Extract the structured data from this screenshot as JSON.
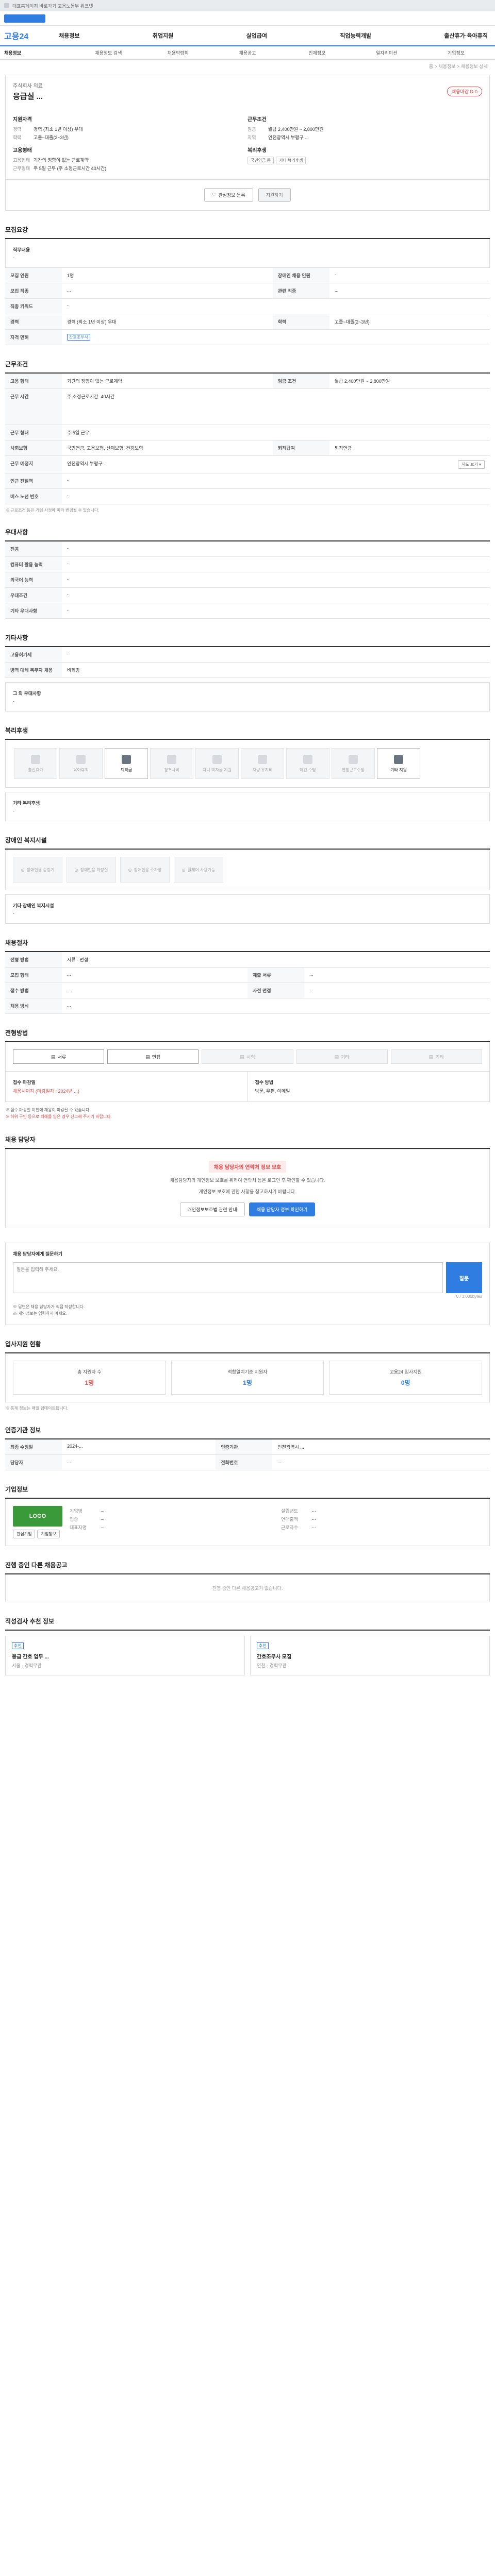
{
  "top": {
    "notice": "대표홈페이지 바로가기 고용노동부 워크넷"
  },
  "header": {
    "logo": "고용24",
    "menu": [
      "채용정보",
      "취업지원",
      "실업급여",
      "직업능력개발",
      "출산휴가·육아휴직"
    ],
    "subnav": [
      "채용정보",
      "채용정보 검색",
      "채용박람회",
      "채용공고",
      "인재정보",
      "일자리미션",
      "기업정보"
    ],
    "breadcrumb": "홈 > 채용정보 > 채용정보 상세"
  },
  "title": {
    "corp": "주식회사 의료",
    "heading": "응급실 ...",
    "badge": "채용마감 D-0"
  },
  "summary": {
    "career_h": "지원자격",
    "career": [
      {
        "k": "경력",
        "v": "경력 (최소 1년 이상) 우대"
      },
      {
        "k": "학력",
        "v": "고졸~대졸(2~3년)"
      }
    ],
    "cond_h": "근무조건",
    "cond": [
      {
        "k": "임금",
        "v": "월급 2,400만원 ~ 2,800만원"
      },
      {
        "k": "지역",
        "v": "인천광역시 부평구 ..."
      }
    ],
    "emp_h": "고용형태",
    "emp": [
      {
        "k": "고용형태",
        "v": "기간의 정함이 없는 근로계약"
      },
      {
        "k": "근무형태",
        "v": "주 5일 근무 (주 소정근로시간 40시간)"
      }
    ],
    "welfare_h": "복리후생",
    "welfare_pills": [
      "국민연금 등",
      "기타 복리후생"
    ]
  },
  "actions": {
    "fav": "관심정보 등록",
    "apply": "지원하기"
  },
  "sections": {
    "recruit": {
      "title": "모집요강",
      "label": "직무내용",
      "val": "-"
    },
    "recruit_tbl": [
      {
        "k": "모집 인원",
        "v": "1명",
        "k2": "장애인 채용 인원",
        "v2": "-"
      },
      {
        "k": "모집 직종",
        "v": "...",
        "k2": "관련 직종",
        "v2": "..."
      },
      {
        "k": "직종 키워드",
        "v": "-",
        "k2": "",
        "v2": ""
      },
      {
        "k": "경력",
        "v": "경력 (최소 1년 이상) 우대",
        "k2": "학력",
        "v2": "고졸~대졸(2~3년)"
      },
      {
        "k": "자격 면허",
        "v": "간호조무사",
        "k2": "",
        "v2": ""
      }
    ],
    "work": {
      "title": "근무조건"
    },
    "work_tbl": [
      {
        "k": "고용 형태",
        "v": "기간의 정함이 없는 근로계약",
        "k2": "임금 조건",
        "v2": "월급 2,400만원 ~ 2,800만원"
      },
      {
        "k": "근무 시간",
        "v": "주 소정근로시간: 40시간",
        "k2": "",
        "v2": ""
      },
      {
        "k": "근무 형태",
        "v": "주 5일 근무",
        "k2": "",
        "v2": ""
      },
      {
        "k": "사회보험",
        "v": "국민연금, 고용보험, 산재보험, 건강보험",
        "k2": "퇴직급여",
        "v2": "퇴직연금"
      },
      {
        "k": "근무 예정지",
        "v": "인천광역시 부평구 ...",
        "k2": "",
        "v2": ""
      },
      {
        "k": "인근 전철역",
        "v": "-",
        "k2": "",
        "v2": ""
      },
      {
        "k": "버스 노선 번호",
        "v": "-",
        "k2": "",
        "v2": ""
      }
    ],
    "work_note": "※ 근로조건 등은 기업 사정에 따라 변경될 수 있습니다.",
    "pref": {
      "title": "우대사항"
    },
    "pref_tbl": [
      {
        "k": "전공",
        "v": "-"
      },
      {
        "k": "컴퓨터 활용 능력",
        "v": "-"
      },
      {
        "k": "외국어 능력",
        "v": "-"
      },
      {
        "k": "우대조건",
        "v": "-"
      },
      {
        "k": "기타 우대사항",
        "v": "-"
      }
    ],
    "etc": {
      "title": "기타사항"
    },
    "etc_tbl": [
      {
        "k": "고용허가제",
        "v": "-"
      },
      {
        "k": "병역 대체 복무자 채용",
        "v": "비희망"
      }
    ],
    "etc_box": {
      "label": "그 외 우대사항",
      "val": "-"
    },
    "welfare": {
      "title": "복리후생"
    },
    "welfare_items": [
      {
        "n": "출산휴가",
        "on": false
      },
      {
        "n": "육아휴직",
        "on": false
      },
      {
        "n": "퇴직금",
        "on": true
      },
      {
        "n": "경조사비",
        "on": false
      },
      {
        "n": "자녀 학자금 지원",
        "on": false
      },
      {
        "n": "차량 유지비",
        "on": false
      },
      {
        "n": "야간 수당",
        "on": false
      },
      {
        "n": "연장근로수당",
        "on": false
      },
      {
        "n": "기타 지원",
        "on": true
      }
    ],
    "welfare_box": {
      "label": "기타 복리후생",
      "val": "-"
    },
    "dis": {
      "title": "장애인 복지시설"
    },
    "dis_items": [
      "장애인용 승강기",
      "장애인용 화장실",
      "장애인용 주차장",
      "휠체어 사용가능"
    ],
    "dis_box": {
      "label": "기타 장애인 복지시설",
      "val": "-"
    },
    "proc": {
      "title": "채용절차"
    },
    "proc_tbl": [
      {
        "k": "전형 방법",
        "v": "서류 - 면접",
        "k2": "",
        "v2": ""
      },
      {
        "k": "모집 형태",
        "v": "...",
        "k2": "제출 서류",
        "v2": "..."
      },
      {
        "k": "접수 방법",
        "v": "...",
        "k2": "사전 면접",
        "v2": "..."
      },
      {
        "k": "채용 방식",
        "v": "...",
        "k2": "",
        "v2": ""
      }
    ],
    "apply": {
      "title": "전형방법"
    },
    "apply_tabs": [
      "서류",
      "면접",
      "시험",
      "기타",
      "기타"
    ],
    "apply_left": {
      "h": "접수 마감일",
      "v": "채용시까지 (마감일자 : 2024년 ...)"
    },
    "apply_right": {
      "h": "접수 방법",
      "v": "방문, 우편, 이메일"
    },
    "apply_bullets": [
      "※ 접수 마감일 이전에 채용이 마감될 수 있습니다.",
      "※ 허위 구인 등으로 피해를 입은 경우 신고해 주시기 바랍니다."
    ],
    "contact": {
      "title": "채용 담당자",
      "warn": "채용 담당자의 연락처 정보 보호",
      "p1": "채용담당자의 개인정보 보호를 위하여 연락처 등은 로그인 후 확인할 수 있습니다.",
      "p2": "개인정보 보호에 관한 사항을 참고하시기 바랍니다.",
      "btn1": "개인정보보호법 관련 안내",
      "btn2": "채용 담당자 정보 확인하기"
    },
    "qa": {
      "title": "채용 담당자에게 질문하기",
      "hint": "질문을 입력해 주세요.",
      "submit": "질문",
      "count": "0 / 1,000bytes",
      "bullets": [
        "※ 답변은 채용 담당자가 직접 작성합니다.",
        "※ 개인정보는 입력하지 마세요."
      ]
    },
    "stats": {
      "title": "입사지원 현황",
      "items": [
        {
          "l": "총 지원자 수",
          "n": "1명"
        },
        {
          "l": "적합일치기준 지원자",
          "n": "1명"
        },
        {
          "l": "고용24 입사지원",
          "n": "0명"
        }
      ],
      "note": "※ 통계 정보는 매일 업데이트됩니다."
    },
    "info": {
      "title": "인증기관 정보"
    },
    "info_tbl": [
      {
        "k": "최종 수정일",
        "v": "2024-...",
        "k2": "인증기관",
        "v2": "인천광역시 ..."
      },
      {
        "k": "담당자",
        "v": "...",
        "k2": "전화번호",
        "v2": "..."
      }
    ],
    "corp": {
      "title": "기업정보",
      "logo": "LOGO",
      "btns": [
        "관심기업",
        "기업정보"
      ],
      "rows1": [
        {
          "k": "기업명",
          "v": "..."
        },
        {
          "k": "업종",
          "v": "..."
        },
        {
          "k": "대표자명",
          "v": "..."
        }
      ],
      "rows2": [
        {
          "k": "설립년도",
          "v": "..."
        },
        {
          "k": "연매출액",
          "v": "..."
        },
        {
          "k": "근로자수",
          "v": "..."
        }
      ]
    },
    "ongoing": {
      "title": "진행 중인 다른 채용공고",
      "empty": "진행 중인 다른 채용공고가 없습니다."
    },
    "recs": {
      "title": "적성검사 추천 정보",
      "items": [
        {
          "chip": "추천",
          "t": "응급 간호 업무 ...",
          "m": "서울 · 경력무관"
        },
        {
          "chip": "추천",
          "t": "간호조무사 모집",
          "m": "인천 · 경력무관"
        }
      ]
    }
  }
}
